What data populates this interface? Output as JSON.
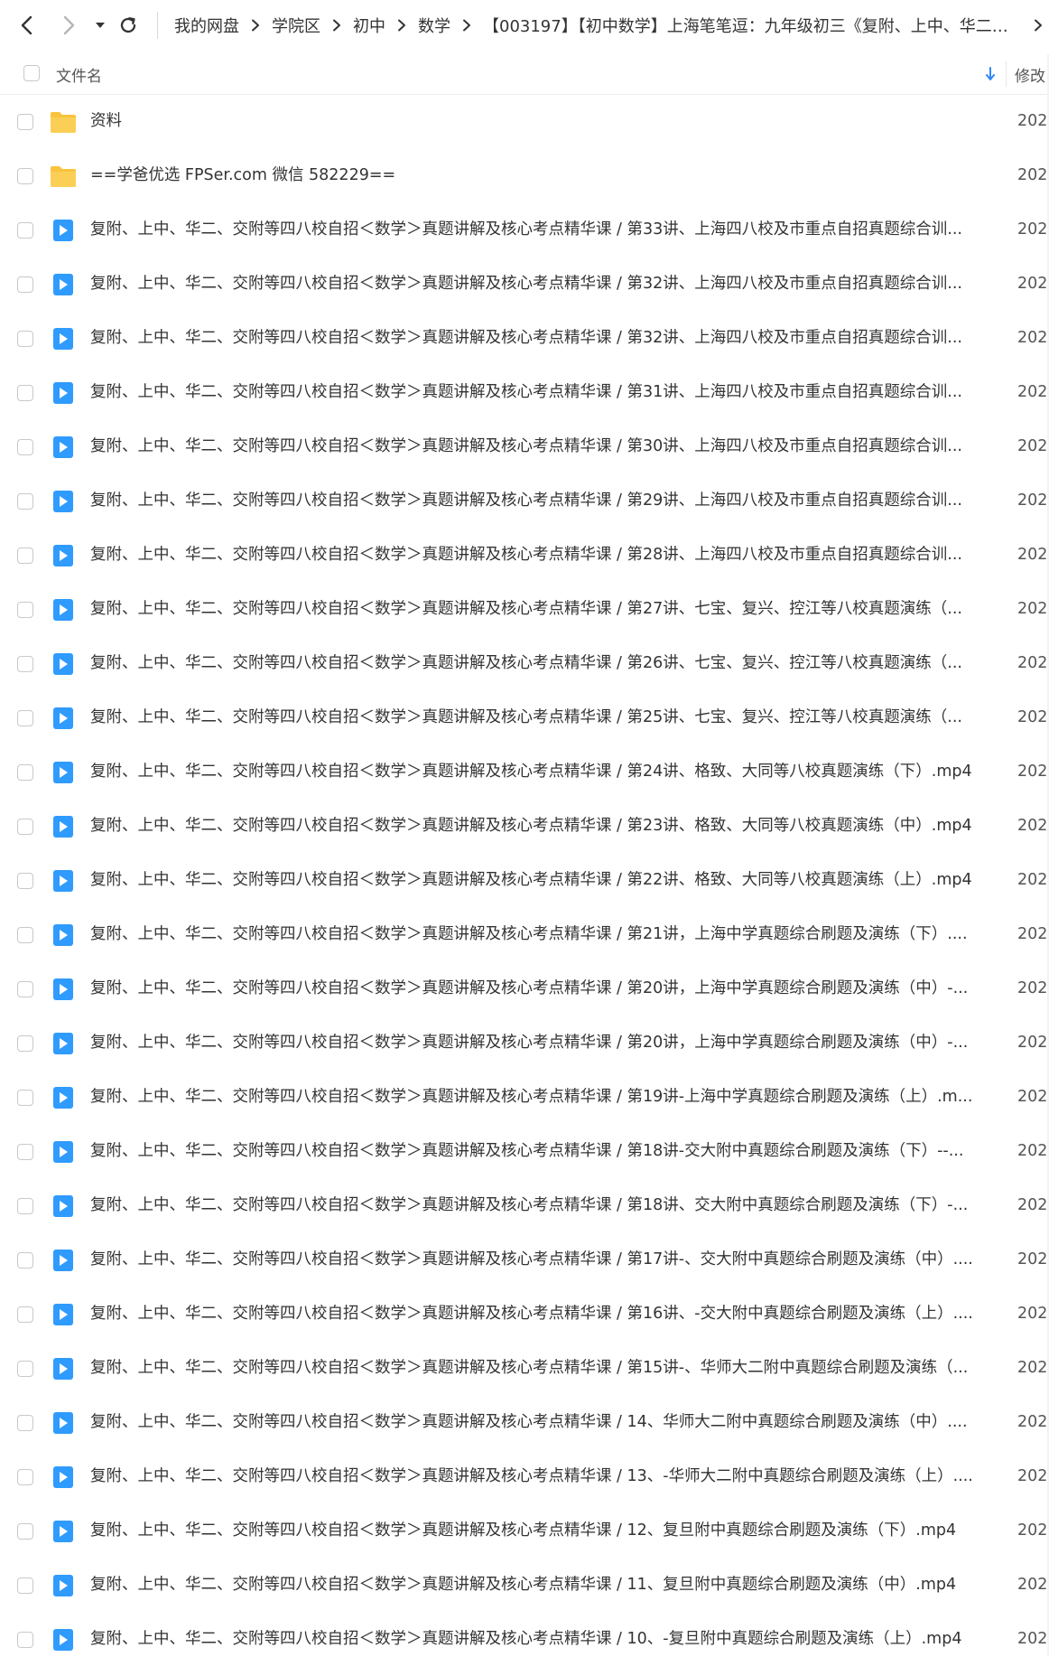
{
  "nav": {
    "back_icon": "chevron-left-icon",
    "forward_icon": "chevron-right-icon",
    "dropdown_icon": "caret-down-icon",
    "refresh_icon": "refresh-icon"
  },
  "breadcrumb": {
    "items": [
      "我的网盘",
      "学院区",
      "初中",
      "数学"
    ],
    "current": "【003197】【初中数学】上海笔笔逗：九年级初三《复附、上中、华二、…",
    "separator_icon": "chevron-right-icon"
  },
  "header": {
    "name_label": "文件名",
    "modified_label": "修改",
    "sort_icon": "arrow-down-icon",
    "sort_color": "#2f88ff"
  },
  "colors": {
    "folder": "#f9c33d",
    "video": "#2f9bff"
  },
  "files": [
    {
      "type": "folder",
      "name": "资料",
      "date": "202"
    },
    {
      "type": "folder",
      "name": "==学爸优选 FPSer.com 微信 582229==",
      "date": "202"
    },
    {
      "type": "video",
      "name": "复附、上中、华二、交附等四八校自招＜数学＞真题讲解及核心考点精华课 / 第33讲、上海四八校及市重点自招真题综合训...",
      "date": "202"
    },
    {
      "type": "video",
      "name": "复附、上中、华二、交附等四八校自招＜数学＞真题讲解及核心考点精华课 / 第32讲、上海四八校及市重点自招真题综合训...",
      "date": "202"
    },
    {
      "type": "video",
      "name": "复附、上中、华二、交附等四八校自招＜数学＞真题讲解及核心考点精华课 / 第32讲、上海四八校及市重点自招真题综合训...",
      "date": "202"
    },
    {
      "type": "video",
      "name": "复附、上中、华二、交附等四八校自招＜数学＞真题讲解及核心考点精华课 / 第31讲、上海四八校及市重点自招真题综合训...",
      "date": "202"
    },
    {
      "type": "video",
      "name": "复附、上中、华二、交附等四八校自招＜数学＞真题讲解及核心考点精华课 / 第30讲、上海四八校及市重点自招真题综合训...",
      "date": "202"
    },
    {
      "type": "video",
      "name": "复附、上中、华二、交附等四八校自招＜数学＞真题讲解及核心考点精华课 / 第29讲、上海四八校及市重点自招真题综合训...",
      "date": "202"
    },
    {
      "type": "video",
      "name": "复附、上中、华二、交附等四八校自招＜数学＞真题讲解及核心考点精华课 / 第28讲、上海四八校及市重点自招真题综合训...",
      "date": "202"
    },
    {
      "type": "video",
      "name": "复附、上中、华二、交附等四八校自招＜数学＞真题讲解及核心考点精华课 / 第27讲、七宝、复兴、控江等八校真题演练（...",
      "date": "202"
    },
    {
      "type": "video",
      "name": "复附、上中、华二、交附等四八校自招＜数学＞真题讲解及核心考点精华课 / 第26讲、七宝、复兴、控江等八校真题演练（...",
      "date": "202"
    },
    {
      "type": "video",
      "name": "复附、上中、华二、交附等四八校自招＜数学＞真题讲解及核心考点精华课 / 第25讲、七宝、复兴、控江等八校真题演练（...",
      "date": "202"
    },
    {
      "type": "video",
      "name": "复附、上中、华二、交附等四八校自招＜数学＞真题讲解及核心考点精华课 / 第24讲、格致、大同等八校真题演练（下）.mp4",
      "date": "202"
    },
    {
      "type": "video",
      "name": "复附、上中、华二、交附等四八校自招＜数学＞真题讲解及核心考点精华课 / 第23讲、格致、大同等八校真题演练（中）.mp4",
      "date": "202"
    },
    {
      "type": "video",
      "name": "复附、上中、华二、交附等四八校自招＜数学＞真题讲解及核心考点精华课 / 第22讲、格致、大同等八校真题演练（上）.mp4",
      "date": "202"
    },
    {
      "type": "video",
      "name": "复附、上中、华二、交附等四八校自招＜数学＞真题讲解及核心考点精华课 / 第21讲，上海中学真题综合刷题及演练（下）....",
      "date": "202"
    },
    {
      "type": "video",
      "name": "复附、上中、华二、交附等四八校自招＜数学＞真题讲解及核心考点精华课 / 第20讲，上海中学真题综合刷题及演练（中）-...",
      "date": "202"
    },
    {
      "type": "video",
      "name": "复附、上中、华二、交附等四八校自招＜数学＞真题讲解及核心考点精华课 / 第20讲，上海中学真题综合刷题及演练（中）-...",
      "date": "202"
    },
    {
      "type": "video",
      "name": "复附、上中、华二、交附等四八校自招＜数学＞真题讲解及核心考点精华课 / 第19讲-上海中学真题综合刷题及演练（上）.m...",
      "date": "202"
    },
    {
      "type": "video",
      "name": "复附、上中、华二、交附等四八校自招＜数学＞真题讲解及核心考点精华课 / 第18讲-交大附中真题综合刷题及演练（下）--...",
      "date": "202"
    },
    {
      "type": "video",
      "name": "复附、上中、华二、交附等四八校自招＜数学＞真题讲解及核心考点精华课 / 第18讲、交大附中真题综合刷题及演练（下）-...",
      "date": "202"
    },
    {
      "type": "video",
      "name": "复附、上中、华二、交附等四八校自招＜数学＞真题讲解及核心考点精华课 / 第17讲-、交大附中真题综合刷题及演练（中）....",
      "date": "202"
    },
    {
      "type": "video",
      "name": "复附、上中、华二、交附等四八校自招＜数学＞真题讲解及核心考点精华课 / 第16讲、-交大附中真题综合刷题及演练（上）....",
      "date": "202"
    },
    {
      "type": "video",
      "name": "复附、上中、华二、交附等四八校自招＜数学＞真题讲解及核心考点精华课 / 第15讲-、华师大二附中真题综合刷题及演练（...",
      "date": "202"
    },
    {
      "type": "video",
      "name": "复附、上中、华二、交附等四八校自招＜数学＞真题讲解及核心考点精华课 / 14、华师大二附中真题综合刷题及演练（中）....",
      "date": "202"
    },
    {
      "type": "video",
      "name": "复附、上中、华二、交附等四八校自招＜数学＞真题讲解及核心考点精华课 / 13、-华师大二附中真题综合刷题及演练（上）....",
      "date": "202"
    },
    {
      "type": "video",
      "name": "复附、上中、华二、交附等四八校自招＜数学＞真题讲解及核心考点精华课 / 12、复旦附中真题综合刷题及演练（下）.mp4",
      "date": "202"
    },
    {
      "type": "video",
      "name": "复附、上中、华二、交附等四八校自招＜数学＞真题讲解及核心考点精华课 / 11、复旦附中真题综合刷题及演练（中）.mp4",
      "date": "202"
    },
    {
      "type": "video",
      "name": "复附、上中、华二、交附等四八校自招＜数学＞真题讲解及核心考点精华课 / 10、-复旦附中真题综合刷题及演练（上）.mp4",
      "date": "202"
    }
  ]
}
